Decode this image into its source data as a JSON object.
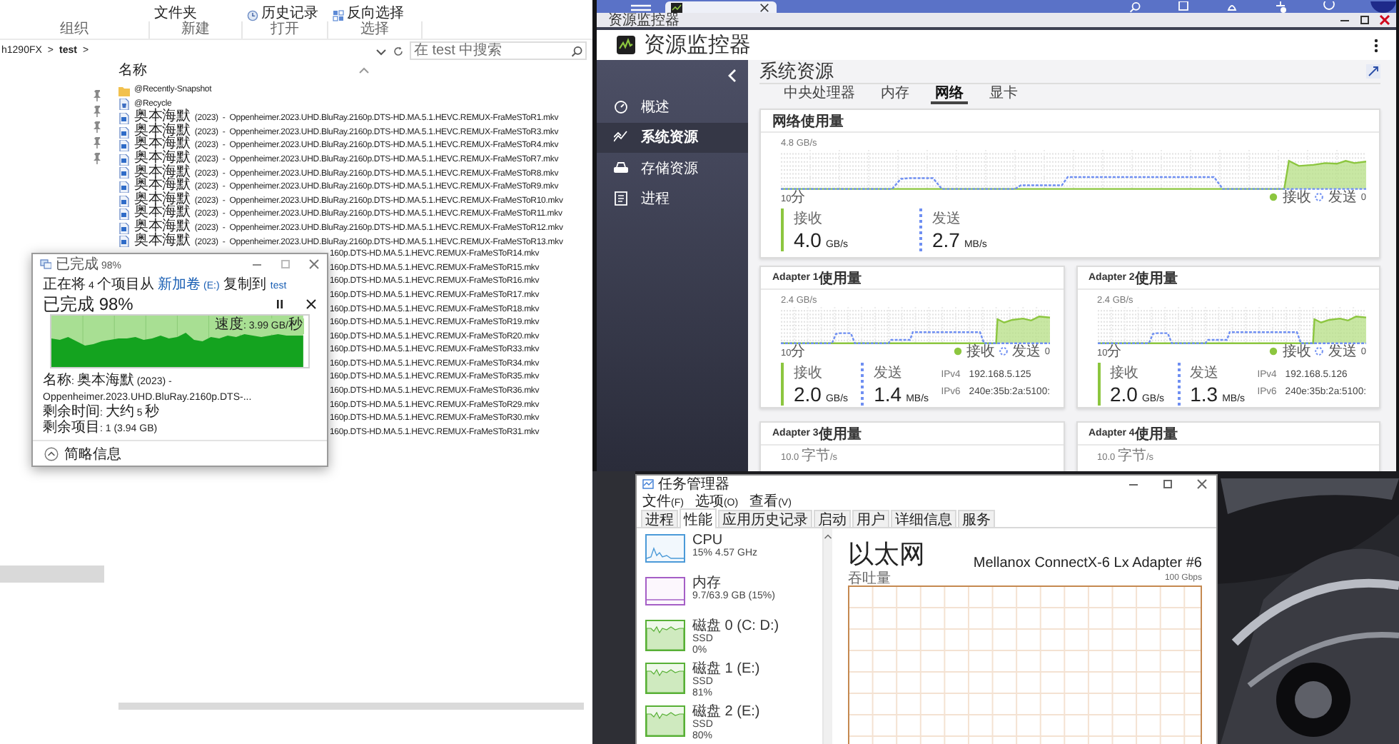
{
  "explorer": {
    "ribbon": {
      "items": [
        {
          "text": "文件夹"
        },
        {
          "text": "历史记录"
        },
        {
          "text": "反向选择"
        }
      ],
      "groups": [
        "组织",
        "新建",
        "打开",
        "选择"
      ]
    },
    "address": {
      "path": [
        "h1290FX",
        "test"
      ],
      "separator": ">"
    },
    "search": {
      "placeholder": "在 test 中搜索"
    },
    "columns": [
      "名称"
    ],
    "files": [
      {
        "name": "@Recently-Snapshot",
        "kind": "folder"
      },
      {
        "name": "@Recycle",
        "kind": "recycle"
      },
      {
        "name": "奥本海默 (2023) - Oppenheimer.2023.UHD.BluRay.2160p.DTS-HD.MA.5.1.HEVC.REMUX-FraMeSToR1.mkv",
        "kind": "video"
      },
      {
        "name": "奥本海默 (2023) - Oppenheimer.2023.UHD.BluRay.2160p.DTS-HD.MA.5.1.HEVC.REMUX-FraMeSToR3.mkv",
        "kind": "video"
      },
      {
        "name": "奥本海默 (2023) - Oppenheimer.2023.UHD.BluRay.2160p.DTS-HD.MA.5.1.HEVC.REMUX-FraMeSToR4.mkv",
        "kind": "video"
      },
      {
        "name": "奥本海默 (2023) - Oppenheimer.2023.UHD.BluRay.2160p.DTS-HD.MA.5.1.HEVC.REMUX-FraMeSToR7.mkv",
        "kind": "video"
      },
      {
        "name": "奥本海默 (2023) - Oppenheimer.2023.UHD.BluRay.2160p.DTS-HD.MA.5.1.HEVC.REMUX-FraMeSToR8.mkv",
        "kind": "video"
      },
      {
        "name": "奥本海默 (2023) - Oppenheimer.2023.UHD.BluRay.2160p.DTS-HD.MA.5.1.HEVC.REMUX-FraMeSToR9.mkv",
        "kind": "video"
      },
      {
        "name": "奥本海默 (2023) - Oppenheimer.2023.UHD.BluRay.2160p.DTS-HD.MA.5.1.HEVC.REMUX-FraMeSToR10.mkv",
        "kind": "video"
      },
      {
        "name": "奥本海默 (2023) - Oppenheimer.2023.UHD.BluRay.2160p.DTS-HD.MA.5.1.HEVC.REMUX-FraMeSToR11.mkv",
        "kind": "video"
      },
      {
        "name": "奥本海默 (2023) - Oppenheimer.2023.UHD.BluRay.2160p.DTS-HD.MA.5.1.HEVC.REMUX-FraMeSToR12.mkv",
        "kind": "video"
      },
      {
        "name": "奥本海默 (2023) - Oppenheimer.2023.UHD.BluRay.2160p.DTS-HD.MA.5.1.HEVC.REMUX-FraMeSToR13.mkv",
        "kind": "video"
      }
    ],
    "files_behind_dialog": [
      "160p.DTS-HD.MA.5.1.HEVC.REMUX-FraMeSToR14.mkv",
      "160p.DTS-HD.MA.5.1.HEVC.REMUX-FraMeSToR15.mkv",
      "160p.DTS-HD.MA.5.1.HEVC.REMUX-FraMeSToR16.mkv",
      "160p.DTS-HD.MA.5.1.HEVC.REMUX-FraMeSToR17.mkv",
      "160p.DTS-HD.MA.5.1.HEVC.REMUX-FraMeSToR18.mkv",
      "160p.DTS-HD.MA.5.1.HEVC.REMUX-FraMeSToR19.mkv",
      "160p.DTS-HD.MA.5.1.HEVC.REMUX-FraMeSToR20.mkv",
      "160p.DTS-HD.MA.5.1.HEVC.REMUX-FraMeSToR33.mkv",
      "160p.DTS-HD.MA.5.1.HEVC.REMUX-FraMeSToR34.mkv",
      "160p.DTS-HD.MA.5.1.HEVC.REMUX-FraMeSToR35.mkv",
      "160p.DTS-HD.MA.5.1.HEVC.REMUX-FraMeSToR36.mkv",
      "160p.DTS-HD.MA.5.1.HEVC.REMUX-FraMeSToR29.mkv",
      "160p.DTS-HD.MA.5.1.HEVC.REMUX-FraMeSToR30.mkv",
      "160p.DTS-HD.MA.5.1.HEVC.REMUX-FraMeSToR31.mkv"
    ]
  },
  "copy_dialog": {
    "title": "已完成 98%",
    "status": {
      "prefix": "正在将 4 个项目从",
      "source": "新加卷 (E:)",
      "middle": "复制到",
      "destination": "test"
    },
    "headline": "已完成 98%",
    "level": 0.98,
    "speed": "速度: 3.99 GB/秒",
    "details": [
      "名称: 奥本海默 (2023) - Oppenheimer.2023.UHD.BluRay.2160p.DTS-...",
      "剩余时间: 大约 5 秒",
      "剩余项目: 1 (3.94 GB)"
    ],
    "footer": "简略信息"
  },
  "resource_monitor": {
    "window_title": "资源监控器",
    "app_title": "资源监控器",
    "sidebar": [
      {
        "label": "概述",
        "selected": false
      },
      {
        "label": "系统资源",
        "selected": true
      },
      {
        "label": "存储资源",
        "selected": false
      },
      {
        "label": "进程",
        "selected": false
      }
    ],
    "page_title": "系统资源",
    "tabs": [
      {
        "label": "中央处理器",
        "selected": false
      },
      {
        "label": "内存",
        "selected": false
      },
      {
        "label": "网络",
        "selected": true
      },
      {
        "label": "显卡",
        "selected": false
      }
    ],
    "cards": [
      {
        "kind": "wide",
        "title": "网络使用量",
        "axis_max": "4.8 GB/s",
        "axis_time": "10分",
        "legend": [
          "接收",
          "发送"
        ],
        "axis_zero": "0",
        "receive": {
          "label": "接收",
          "value": "4.0",
          "unit": "GB/s"
        },
        "send": {
          "label": "发送",
          "value": "2.7",
          "unit": "MB/s"
        }
      },
      {
        "kind": "adapter",
        "title": "Adapter 1使用量",
        "axis_max": "2.4 GB/s",
        "axis_time": "10分",
        "legend": [
          "接收",
          "发送"
        ],
        "axis_zero": "0",
        "receive": {
          "label": "接收",
          "value": "2.0",
          "unit": "GB/s"
        },
        "send": {
          "label": "发送",
          "value": "1.4",
          "unit": "MB/s"
        },
        "addresses": [
          {
            "label": "IPv4",
            "value": "192.168.5.125"
          },
          {
            "label": "IPv6",
            "value": "240e:35b:2a:5100:"
          }
        ]
      },
      {
        "kind": "adapter",
        "title": "Adapter 2使用量",
        "axis_max": "2.4 GB/s",
        "axis_time": "10分",
        "legend": [
          "接收",
          "发送"
        ],
        "axis_zero": "0",
        "receive": {
          "label": "接收",
          "value": "2.0",
          "unit": "GB/s"
        },
        "send": {
          "label": "发送",
          "value": "1.3",
          "unit": "MB/s"
        },
        "addresses": [
          {
            "label": "IPv4",
            "value": "192.168.5.126"
          },
          {
            "label": "IPv6",
            "value": "240e:35b:2a:5100:"
          }
        ]
      },
      {
        "kind": "cut",
        "title": "Adapter 3使用量",
        "axis_max": "10.0 字节/s"
      },
      {
        "kind": "cut",
        "title": "Adapter 4使用量",
        "axis_max": "10.0 字节/s"
      }
    ]
  },
  "task_manager": {
    "title": "任务管理器",
    "menu": [
      "文件(F)",
      "选项(O)",
      "查看(V)"
    ],
    "tabs": [
      {
        "label": "进程",
        "selected": false
      },
      {
        "label": "性能",
        "selected": true
      },
      {
        "label": "应用历史记录",
        "selected": false
      },
      {
        "label": "启动",
        "selected": false
      },
      {
        "label": "用户",
        "selected": false
      },
      {
        "label": "详细信息",
        "selected": false
      },
      {
        "label": "服务",
        "selected": false
      }
    ],
    "resources": [
      {
        "kind": "cpu",
        "name": "CPU",
        "details": [
          "15% 4.57 GHz"
        ]
      },
      {
        "kind": "memory",
        "name": "内存",
        "details": [
          "9.7/63.9 GB (15%)"
        ]
      },
      {
        "kind": "disk",
        "name": "磁盘 0 (C: D:)",
        "details": [
          "SSD",
          "0%"
        ]
      },
      {
        "kind": "disk",
        "name": "磁盘 1 (E:)",
        "details": [
          "SSD",
          "81%"
        ]
      },
      {
        "kind": "disk",
        "name": "磁盘 2 (E:)",
        "details": [
          "SSD",
          "80%"
        ]
      }
    ],
    "detail": {
      "title": "以太网",
      "device": "Mellanox ConnectX-6 Lx Adapter #6",
      "graph_label": "吞吐量",
      "graph_max": "100 Gbps"
    }
  }
}
